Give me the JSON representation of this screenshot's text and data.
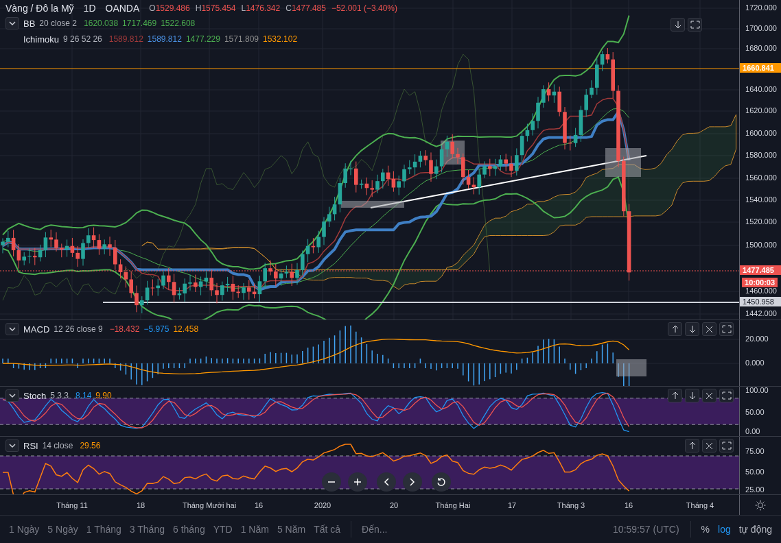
{
  "header": {
    "symbol": "Vàng / Đô la Mỹ",
    "interval": "1D",
    "exchange": "OANDA",
    "ohlc": [
      {
        "label": "O",
        "value": "1529.486"
      },
      {
        "label": "H",
        "value": "1575.454"
      },
      {
        "label": "L",
        "value": "1476.342"
      },
      {
        "label": "C",
        "value": "1477.485"
      }
    ],
    "change": "−52.001 (−3.40%)"
  },
  "indicators": [
    {
      "name": "BB",
      "params": "20 close 2",
      "values": [
        {
          "text": "1620.038",
          "color": "#4caf50"
        },
        {
          "text": "1717.469",
          "color": "#4caf50"
        },
        {
          "text": "1522.608",
          "color": "#4caf50"
        }
      ]
    },
    {
      "name": "Ichimoku",
      "params": "9 26 52 26",
      "values": [
        {
          "text": "1589.812",
          "color": "#a33a3a"
        },
        {
          "text": "1589.812",
          "color": "#4a90e2"
        },
        {
          "text": "1477.229",
          "color": "#4caf50"
        },
        {
          "text": "1571.809",
          "color": "#8e8e8e"
        },
        {
          "text": "1532.102",
          "color": "#ff9800"
        }
      ]
    }
  ],
  "price_axis": {
    "ticks": [
      "1720.000",
      "1700.000",
      "1680.000",
      "1640.000",
      "1620.000",
      "1600.000",
      "1580.000",
      "1560.000",
      "1540.000",
      "1520.000",
      "1500.000",
      "1460.000",
      "1442.000"
    ],
    "labels": [
      {
        "text": "1660.841",
        "kind": "alert"
      },
      {
        "text": "1477.485",
        "kind": "last"
      },
      {
        "text": "10:00:03",
        "kind": "countdown"
      },
      {
        "text": "1450.958",
        "kind": "line"
      }
    ]
  },
  "panes": [
    {
      "kind": "macd",
      "name": "MACD",
      "params": "12 26 close 9",
      "values": [
        {
          "text": "−18.432",
          "color": "#ef5350"
        },
        {
          "text": "−5.975",
          "color": "#2196f3"
        },
        {
          "text": "12.458",
          "color": "#ff9800"
        }
      ],
      "ticks": [
        "20.000",
        "0.000"
      ]
    },
    {
      "kind": "stoch",
      "name": "Stoch",
      "params": "5 3 3",
      "values": [
        {
          "text": "8.14",
          "color": "#2196f3"
        },
        {
          "text": "9.90",
          "color": "#ff9800"
        }
      ],
      "ticks": [
        "100.00",
        "50.00",
        "0.00"
      ]
    },
    {
      "kind": "rsi",
      "name": "RSI",
      "params": "14 close",
      "values": [
        {
          "text": "29.56",
          "color": "#ff9800"
        }
      ],
      "ticks": [
        "75.00",
        "50.00",
        "25.00"
      ]
    }
  ],
  "time_axis": [
    "Tháng 11",
    "18",
    "Tháng Mười hai",
    "16",
    "2020",
    "20",
    "Tháng Hai",
    "17",
    "Tháng 3",
    "16",
    "Tháng 4"
  ],
  "toolbar": {
    "ranges": [
      "1 Ngày",
      "5 Ngày",
      "1 Tháng",
      "3 Tháng",
      "6 tháng",
      "YTD",
      "1 Năm",
      "5 Năm",
      "Tất cả"
    ],
    "goto": "Đến...",
    "clock": "10:59:57 (UTC)",
    "options": [
      {
        "label": "%",
        "selected": false
      },
      {
        "label": "log",
        "selected": true
      },
      {
        "label": "tự động",
        "selected": false
      }
    ]
  }
}
